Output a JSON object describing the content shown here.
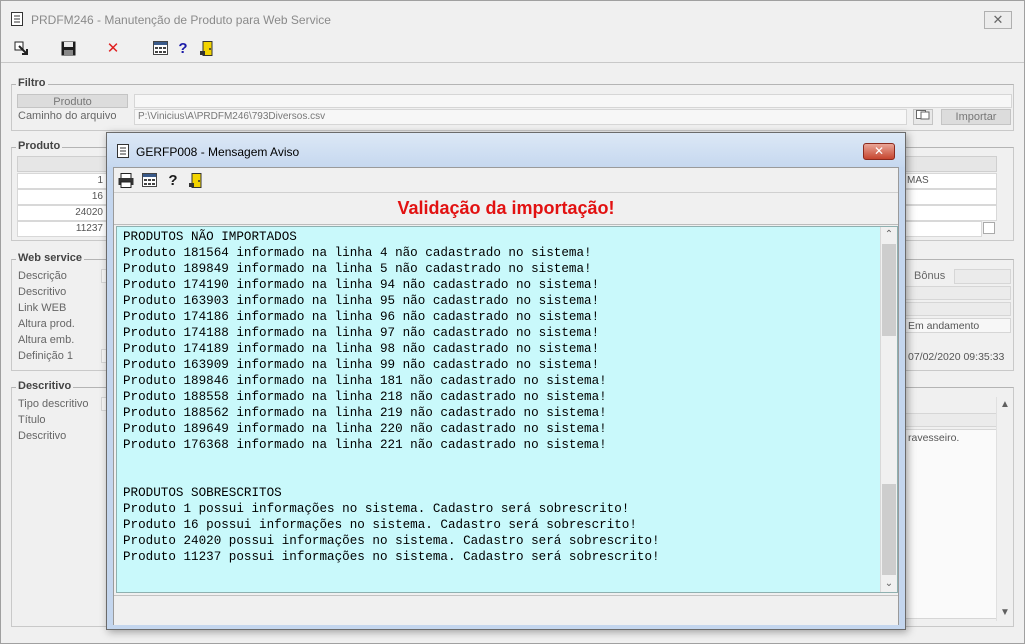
{
  "main_window": {
    "title": "PRDFM246 - Manutenção de Produto para Web Service",
    "close_symbol": "✕"
  },
  "main_toolbar": {
    "icons": [
      "exit-arrow-icon",
      "save-icon",
      "delete-icon",
      "calculator-icon",
      "help-icon",
      "door-exit-icon"
    ]
  },
  "filtro": {
    "legend": "Filtro",
    "produto_button": "Produto",
    "caminho_label": "Caminho do arquivo",
    "caminho_value": "P:\\Vinicius\\A\\PRDFM246\\793Diversos.csv",
    "importar_button": "Importar"
  },
  "produto": {
    "legend": "Produto",
    "rows": [
      "1",
      "16",
      "24020",
      "11237"
    ],
    "right_cell": "MAS"
  },
  "web_service": {
    "legend": "Web service",
    "labels": [
      "Descrição",
      "Descritivo",
      "Link WEB",
      "Altura prod.",
      "Altura emb.",
      "Definição 1"
    ],
    "bonus_label": "Bônus",
    "status_value": "Em andamento",
    "datetime_value": "07/02/2020 09:35:33"
  },
  "descritivo": {
    "legend": "Descritivo",
    "labels": [
      "Tipo descritivo",
      "Título",
      "Descritivo"
    ],
    "right_text": "ravesseiro."
  },
  "dialog": {
    "title": "GERFP008 - Mensagem Aviso",
    "close_symbol": "✕",
    "heading": "Validação da importação!",
    "lines": [
      "PRODUTOS NÃO IMPORTADOS",
      "Produto 181564 informado na linha 4 não cadastrado no sistema!",
      "Produto 189849 informado na linha 5 não cadastrado no sistema!",
      "Produto 174190 informado na linha 94 não cadastrado no sistema!",
      "Produto 163903 informado na linha 95 não cadastrado no sistema!",
      "Produto 174186 informado na linha 96 não cadastrado no sistema!",
      "Produto 174188 informado na linha 97 não cadastrado no sistema!",
      "Produto 174189 informado na linha 98 não cadastrado no sistema!",
      "Produto 163909 informado na linha 99 não cadastrado no sistema!",
      "Produto 189846 informado na linha 181 não cadastrado no sistema!",
      "Produto 188558 informado na linha 218 não cadastrado no sistema!",
      "Produto 188562 informado na linha 219 não cadastrado no sistema!",
      "Produto 189649 informado na linha 220 não cadastrado no sistema!",
      "Produto 176368 informado na linha 221 não cadastrado no sistema!",
      "",
      "",
      "PRODUTOS SOBRESCRITOS",
      "Produto 1 possui informações no sistema. Cadastro será sobrescrito!",
      "Produto 16 possui informações no sistema. Cadastro será sobrescrito!",
      "Produto 24020 possui informações no sistema. Cadastro será sobrescrito!",
      "Produto 11237 possui informações no sistema. Cadastro será sobrescrito!"
    ]
  },
  "colors": {
    "heading_red": "#e21111",
    "message_bg": "#c9f9fb"
  }
}
